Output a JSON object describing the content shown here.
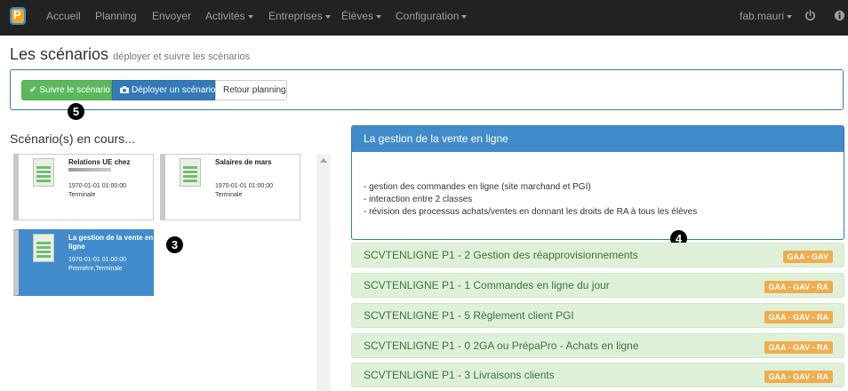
{
  "nav": {
    "logo_letter": "P",
    "items": [
      "Accueil",
      "Planning",
      "Envoyer",
      "Activités",
      "Entreprises",
      "Élèves",
      "Configuration"
    ],
    "user": "fab.mauri",
    "power_icon": "power-icon",
    "info_icon": "info-icon"
  },
  "header": {
    "title": "Les scénarios",
    "subtitle": "déployer et suivre les scénarios"
  },
  "toolbar": {
    "follow_label": "Suivre le scénario",
    "deploy_label": "Déployer un scénario",
    "back_label": "Retour planning"
  },
  "markers": {
    "m5": "5",
    "m3": "3",
    "m4": "4"
  },
  "scenarios": {
    "title": "Scénario(s) en cours...",
    "cards": [
      {
        "title": "Relations UE chez",
        "date": "1970-01-01 01:00:00",
        "level": "Terminale"
      },
      {
        "title": "Salaires de mars",
        "date": "1970-01-01 01:00:00",
        "level": "Terminale"
      },
      {
        "title": "La gestion de la vente en ligne",
        "date": "1970-01-01 01:00:00",
        "level": "Première,Terminale"
      }
    ]
  },
  "detail": {
    "title": "La gestion de la vente en ligne",
    "lines": [
      "- gestion des commandes en ligne (site marchand et PGI)",
      "- interaction entre 2 classes",
      "- révision des processus achats/ventes en donnant les droits de RA à tous les élèves"
    ]
  },
  "steps": [
    {
      "label": "SCVTENLIGNE P1 - 2 Gestion des réapprovisionnements",
      "badge": "GAA - GAV"
    },
    {
      "label": "SCVTENLIGNE P1 - 1 Commandes en ligne du jour",
      "badge": "GAA - GAV - RA"
    },
    {
      "label": "SCVTENLIGNE P1 - 5 Règlement client PGI",
      "badge": "GAA - GAV - RA"
    },
    {
      "label": "SCVTENLIGNE P1 - 0 2GA ou PrépaPro - Achats en ligne",
      "badge": "GAA - GAV - RA"
    },
    {
      "label": "SCVTENLIGNE P1 - 3 Livraisons clients",
      "badge": "GAA - GAV - RA"
    }
  ]
}
